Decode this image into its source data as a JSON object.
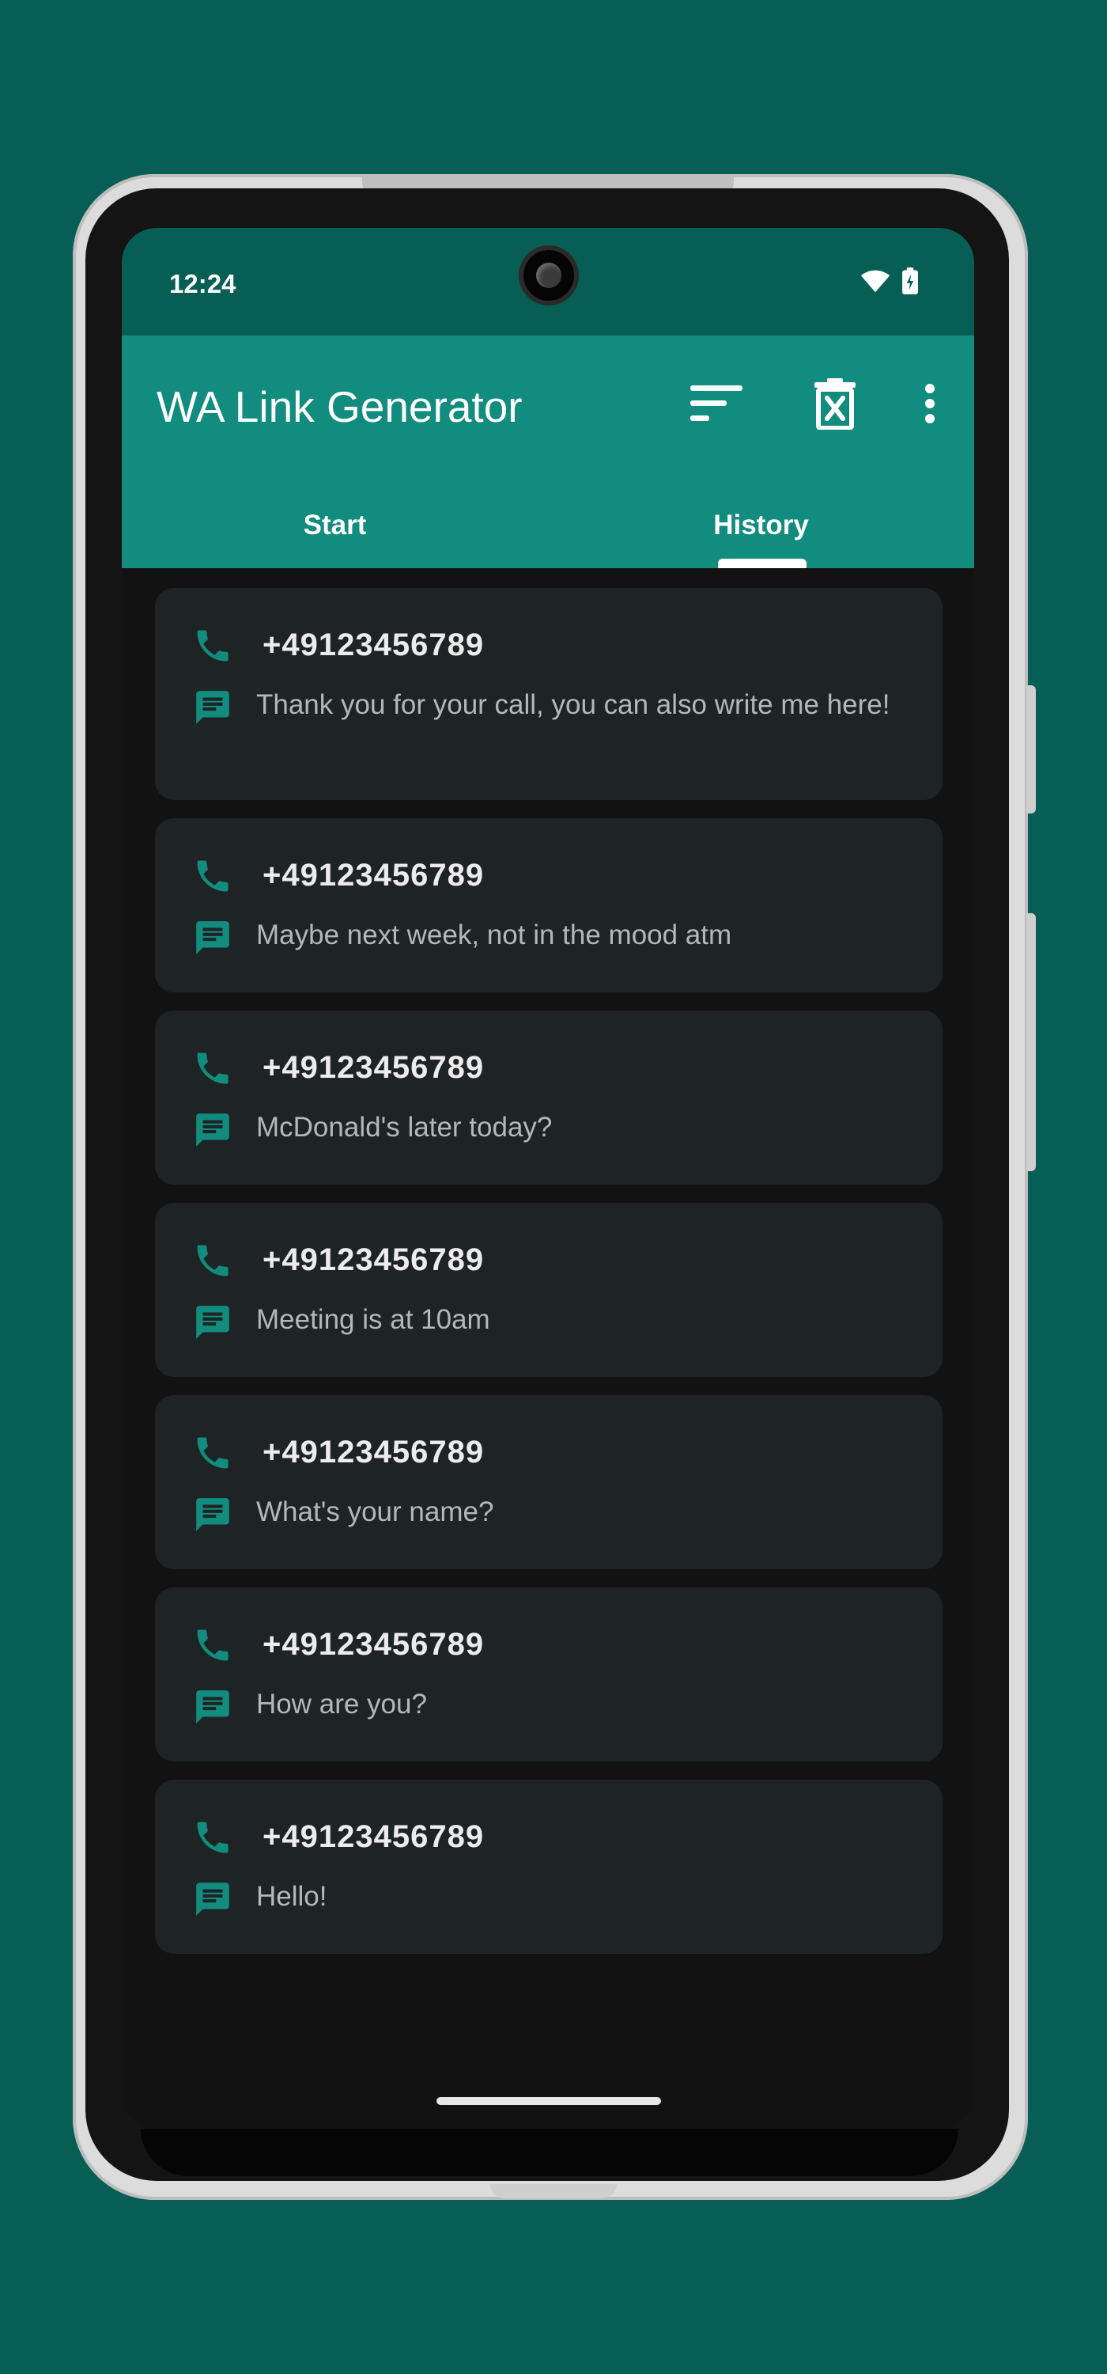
{
  "status_bar": {
    "time": "12:24",
    "icons": [
      "wifi-icon",
      "battery-charging-icon"
    ]
  },
  "app_bar": {
    "title": "WA Link Generator",
    "actions": [
      "sort-icon",
      "clear-history-icon",
      "more-vert-icon"
    ]
  },
  "tabs": [
    {
      "label": "Start",
      "selected": false
    },
    {
      "label": "History",
      "selected": true
    }
  ],
  "history": [
    {
      "number": "+49123456789",
      "message": "Thank you for your call, you can also write me here!"
    },
    {
      "number": "+49123456789",
      "message": "Maybe next week, not in the mood atm"
    },
    {
      "number": "+49123456789",
      "message": "McDonald's later today?"
    },
    {
      "number": "+49123456789",
      "message": "Meeting is at 10am"
    },
    {
      "number": "+49123456789",
      "message": "What's your name?"
    },
    {
      "number": "+49123456789",
      "message": "How are you?"
    },
    {
      "number": "+49123456789",
      "message": "Hello!"
    }
  ],
  "colors": {
    "background": "#075e54",
    "status_bar": "#075e54",
    "app_bar": "#128c7e",
    "screen_bg": "#121212",
    "card_bg": "#1e2424",
    "accent_icon": "#128c7e"
  }
}
